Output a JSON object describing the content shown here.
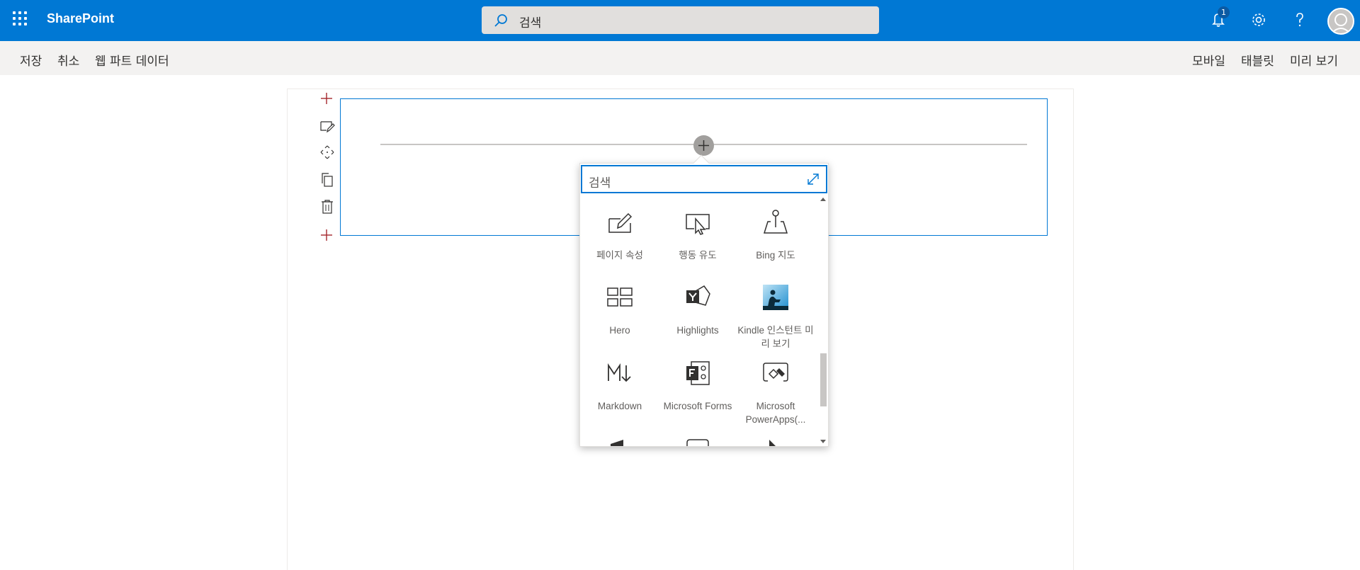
{
  "app": {
    "name": "SharePoint"
  },
  "top_search": {
    "placeholder": "검색"
  },
  "notifications": {
    "count": "1"
  },
  "commands": {
    "save": "저장",
    "cancel": "취소",
    "webpart_data": "웹 파트 데이터",
    "mobile": "모바일",
    "tablet": "태블릿",
    "preview": "미리 보기"
  },
  "toolbox": {
    "search_placeholder": "검색",
    "items": [
      {
        "label": "페이지 속성",
        "icon": "page-properties-icon"
      },
      {
        "label": "행동 유도",
        "icon": "call-to-action-icon"
      },
      {
        "label": "Bing 지도",
        "icon": "bing-maps-icon"
      },
      {
        "label": "Hero",
        "icon": "hero-icon"
      },
      {
        "label": "Highlights",
        "icon": "highlights-icon"
      },
      {
        "label": "Kindle 인스턴트 미리 보기",
        "icon": "kindle-icon"
      },
      {
        "label": "Markdown",
        "icon": "markdown-icon"
      },
      {
        "label": "Microsoft Forms",
        "icon": "microsoft-forms-icon"
      },
      {
        "label": "Microsoft PowerApps(...",
        "icon": "powerapps-icon"
      }
    ]
  },
  "colors": {
    "brand": "#0078d4",
    "accent": "#0078d4"
  }
}
